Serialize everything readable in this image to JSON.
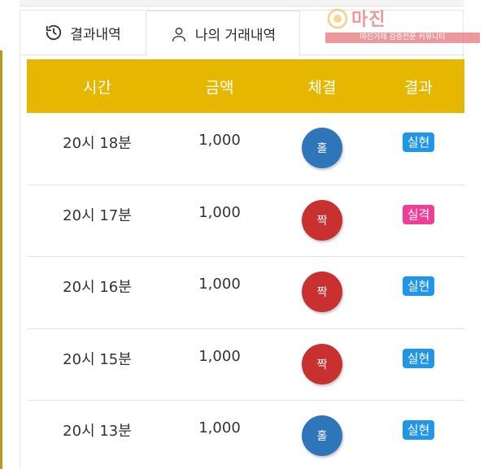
{
  "tabs": [
    {
      "label": "결과내역",
      "icon": "history-icon",
      "active": false
    },
    {
      "label": "나의 거래내역",
      "icon": "user-icon",
      "active": true
    }
  ],
  "watermark": {
    "title": "마진",
    "subtitle": "마진거래 검증전문 커뮤니티"
  },
  "table": {
    "headers": [
      "시간",
      "금액",
      "체결",
      "결과"
    ],
    "rows": [
      {
        "time": "20시 18분",
        "amount": "1,000",
        "pick": "홀",
        "pick_color": "blue",
        "result": "실현",
        "result_type": "win"
      },
      {
        "time": "20시 17분",
        "amount": "1,000",
        "pick": "짝",
        "pick_color": "red",
        "result": "실격",
        "result_type": "lose"
      },
      {
        "time": "20시 16분",
        "amount": "1,000",
        "pick": "짝",
        "pick_color": "red",
        "result": "실현",
        "result_type": "win"
      },
      {
        "time": "20시 15분",
        "amount": "1,000",
        "pick": "짝",
        "pick_color": "red",
        "result": "실현",
        "result_type": "win"
      },
      {
        "time": "20시 13분",
        "amount": "1,000",
        "pick": "홀",
        "pick_color": "blue",
        "result": "실현",
        "result_type": "win"
      }
    ]
  },
  "colors": {
    "header_bg": "#e5b700",
    "odd_ball": "#2f75b9",
    "even_ball": "#c93030",
    "win_badge": "#2196e6",
    "lose_badge": "#ef3e97"
  }
}
